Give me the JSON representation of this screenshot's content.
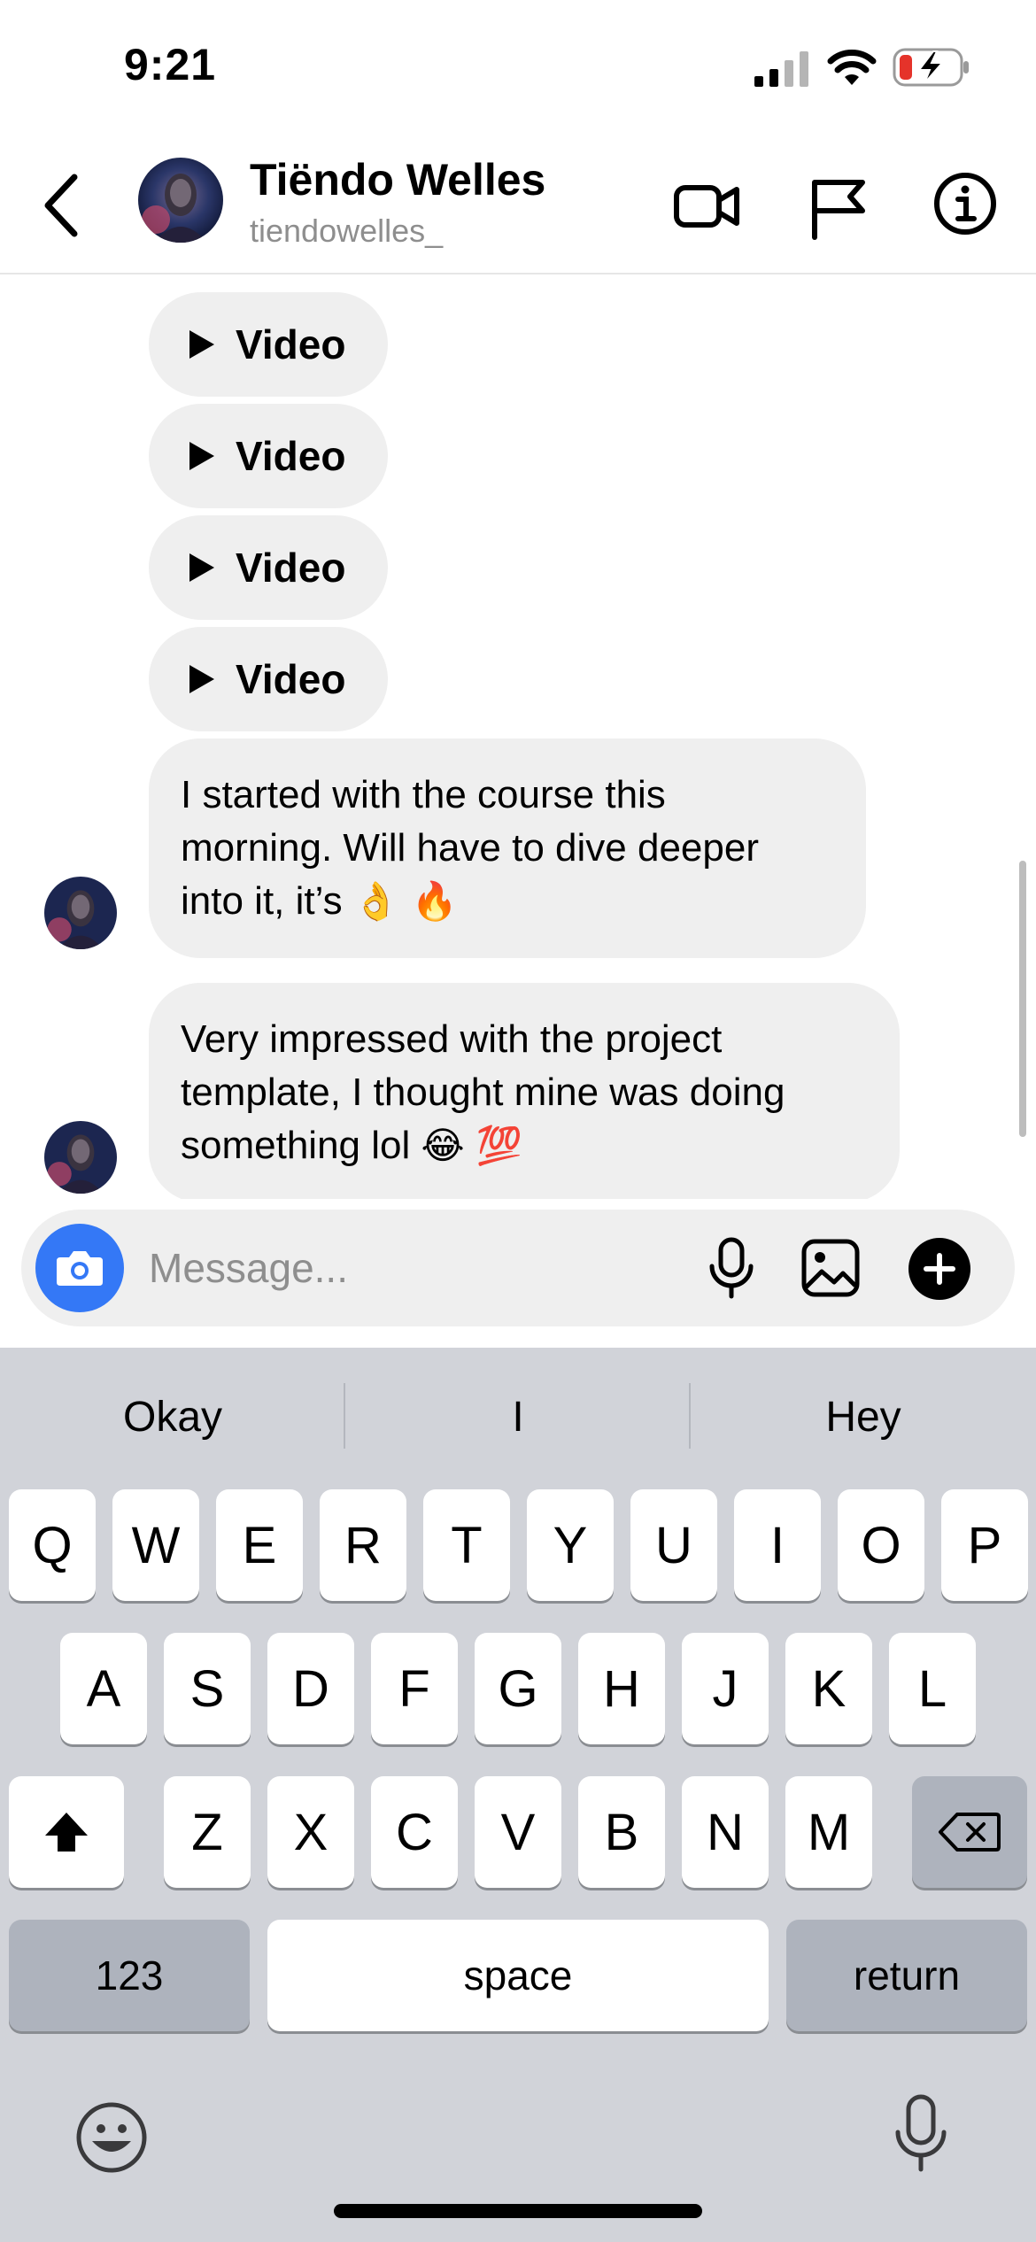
{
  "status_bar": {
    "time": "9:21"
  },
  "header": {
    "contact_name": "Tiëndo Welles",
    "contact_handle": "tiendowelles_",
    "icons": [
      "back-icon",
      "video-call-icon",
      "flag-icon",
      "info-icon"
    ]
  },
  "messages": {
    "videos": [
      {
        "label": "Video"
      },
      {
        "label": "Video"
      },
      {
        "label": "Video"
      },
      {
        "label": "Video"
      }
    ],
    "texts": [
      {
        "lines": [
          "I started with the course this",
          "morning. Will have to dive deeper",
          "into it, it’s"
        ],
        "emojis": "👌 🔥"
      },
      {
        "lines": [
          "Very impressed with the project",
          "template, I thought mine was doing",
          "something lol"
        ],
        "emojis": "😂  💯"
      }
    ]
  },
  "composer": {
    "placeholder": "Message...",
    "icons": [
      "camera-icon",
      "microphone-icon",
      "gallery-icon",
      "plus-icon"
    ],
    "accent_color": "#3478f6"
  },
  "keyboard": {
    "suggestions": [
      "Okay",
      "I",
      "Hey"
    ],
    "row1": [
      "Q",
      "W",
      "E",
      "R",
      "T",
      "Y",
      "U",
      "I",
      "O",
      "P"
    ],
    "row2": [
      "A",
      "S",
      "D",
      "F",
      "G",
      "H",
      "J",
      "K",
      "L"
    ],
    "row3": [
      "Z",
      "X",
      "C",
      "V",
      "B",
      "N",
      "M"
    ],
    "numbers_label": "123",
    "space_label": "space",
    "return_label": "return",
    "background_color": "#d1d3d9"
  }
}
